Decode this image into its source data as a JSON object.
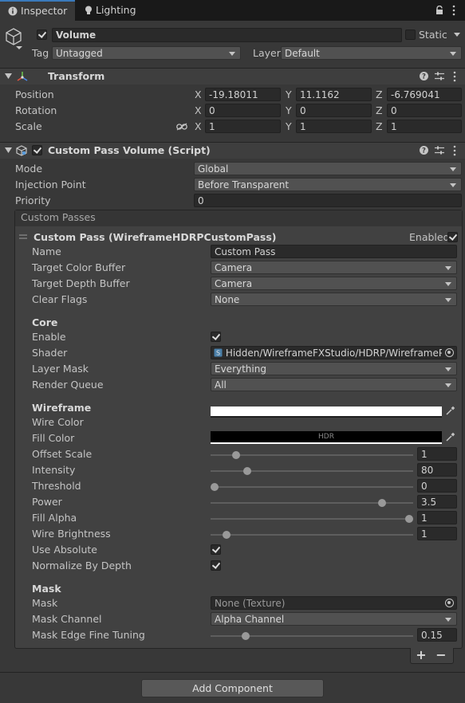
{
  "tabs": [
    {
      "label": "Inspector",
      "icon": "info-icon"
    },
    {
      "label": "Lighting",
      "icon": "lightbulb-icon"
    }
  ],
  "object": {
    "name": "Volume",
    "active": true,
    "static_label": "Static",
    "tag_label": "Tag",
    "tag_value": "Untagged",
    "layer_label": "Layer",
    "layer_value": "Default"
  },
  "transform": {
    "title": "Transform",
    "position_label": "Position",
    "rotation_label": "Rotation",
    "scale_label": "Scale",
    "axes": [
      "X",
      "Y",
      "Z"
    ],
    "position": [
      "-19.18011",
      "11.1162",
      "-6.769041"
    ],
    "rotation": [
      "0",
      "0",
      "0"
    ],
    "scale": [
      "1",
      "1",
      "1"
    ]
  },
  "custom_pass_volume": {
    "title": "Custom Pass Volume (Script)",
    "enabled": true,
    "mode_label": "Mode",
    "mode_value": "Global",
    "injection_label": "Injection Point",
    "injection_value": "Before Transparent",
    "priority_label": "Priority",
    "priority_value": "0",
    "custom_passes_label": "Custom Passes"
  },
  "custom_pass": {
    "title": "Custom Pass (WireframeHDRPCustomPass)",
    "enabled_label": "Enabled",
    "enabled": true,
    "name_label": "Name",
    "name_value": "Custom Pass",
    "target_color_label": "Target Color Buffer",
    "target_color_value": "Camera",
    "target_depth_label": "Target Depth Buffer",
    "target_depth_value": "Camera",
    "clear_flags_label": "Clear Flags",
    "clear_flags_value": "None",
    "core_header": "Core",
    "enable_label": "Enable",
    "enable_value": true,
    "shader_label": "Shader",
    "shader_value": "Hidden/WireframeFXStudio/HDRP/WireframePos",
    "layer_mask_label": "Layer Mask",
    "layer_mask_value": "Everything",
    "render_queue_label": "Render Queue",
    "render_queue_value": "All",
    "wireframe_header": "Wireframe",
    "wire_color_label": "Wire Color",
    "wire_color": "#ffffff",
    "fill_color_label": "Fill Color",
    "fill_color": "#000000",
    "fill_color_hdr": "HDR",
    "sliders": [
      {
        "label": "Offset Scale",
        "value": "1",
        "fraction": 0.11
      },
      {
        "label": "Intensity",
        "value": "80",
        "fraction": 0.17
      },
      {
        "label": "Threshold",
        "value": "0",
        "fraction": 0.0
      },
      {
        "label": "Power",
        "value": "3.5",
        "fraction": 0.86
      },
      {
        "label": "Fill Alpha",
        "value": "1",
        "fraction": 1.0
      },
      {
        "label": "Wire Brightness",
        "value": "1",
        "fraction": 0.06
      }
    ],
    "use_absolute_label": "Use Absolute",
    "use_absolute": true,
    "normalize_label": "Normalize By Depth",
    "normalize": true,
    "mask_header": "Mask",
    "mask_label": "Mask",
    "mask_value": "None (Texture)",
    "mask_channel_label": "Mask Channel",
    "mask_channel_value": "Alpha Channel",
    "mask_edge_label": "Mask Edge Fine Tuning",
    "mask_edge_value": "0.15",
    "mask_edge_fraction": 0.16
  },
  "footer": {
    "plus": "+",
    "minus": "−",
    "add_component": "Add Component"
  }
}
